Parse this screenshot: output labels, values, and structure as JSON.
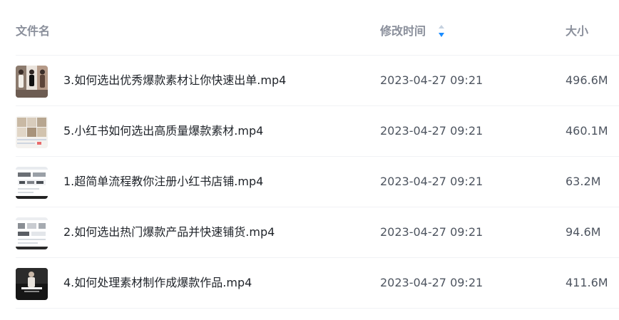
{
  "columns": {
    "name": "文件名",
    "modified": "修改时间",
    "size": "大小"
  },
  "sort": {
    "active_color": "#1a8cff",
    "inactive_color": "#c5d1df"
  },
  "files": [
    {
      "name": "3.如何选出优秀爆款素材让你快速出单.mp4",
      "modified": "2023-04-27 09:21",
      "size": "496.6M",
      "thumbnail": "video-thumbnail-portraits"
    },
    {
      "name": "5.小红书如何选出高质量爆款素材.mp4",
      "modified": "2023-04-27 09:21",
      "size": "460.1M",
      "thumbnail": "video-thumbnail-grid"
    },
    {
      "name": "1.超简单流程教你注册小红书店铺.mp4",
      "modified": "2023-04-27 09:21",
      "size": "63.2M",
      "thumbnail": "video-thumbnail-screen"
    },
    {
      "name": "2.如何选出热门爆款产品并快速铺货.mp4",
      "modified": "2023-04-27 09:21",
      "size": "94.6M",
      "thumbnail": "video-thumbnail-screen"
    },
    {
      "name": "4.如何处理素材制作成爆款作品.mp4",
      "modified": "2023-04-27 09:21",
      "size": "411.6M",
      "thumbnail": "video-thumbnail-dark"
    }
  ]
}
